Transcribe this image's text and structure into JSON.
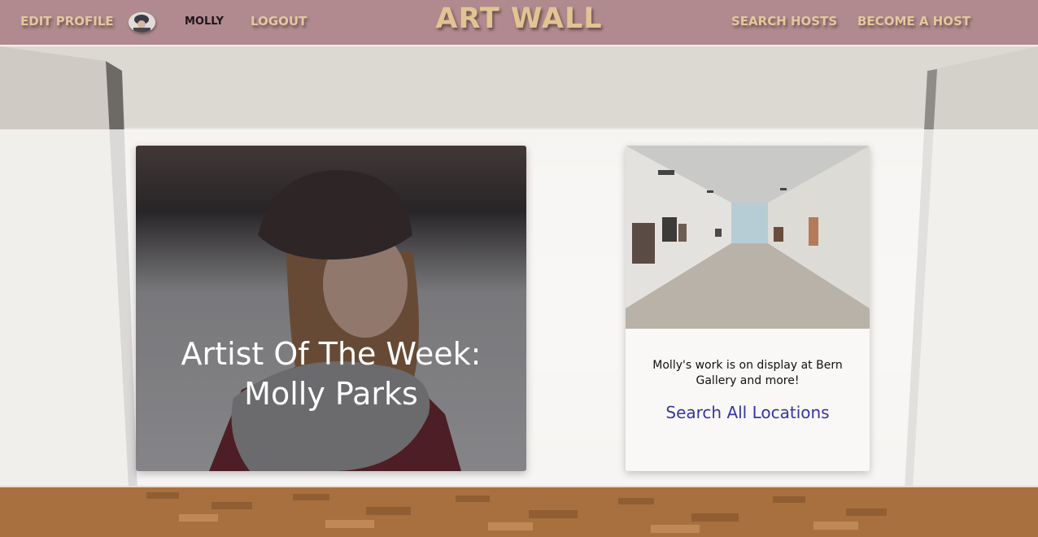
{
  "nav": {
    "edit_profile": "Edit Profile",
    "username": "Molly",
    "logout": "Logout",
    "brand": "Art Wall",
    "search_hosts": "Search Hosts",
    "become_host": "Become A Host"
  },
  "featured": {
    "title_line1": "Artist Of The Week:",
    "title_line2": "Molly Parks"
  },
  "location_card": {
    "description": "Molly's work is on display at Bern Gallery and more!",
    "link_label": "Search All Locations"
  },
  "colors": {
    "navbar": "#b08a8f",
    "nav_text": "#e6c79c",
    "link": "#3436a6"
  }
}
